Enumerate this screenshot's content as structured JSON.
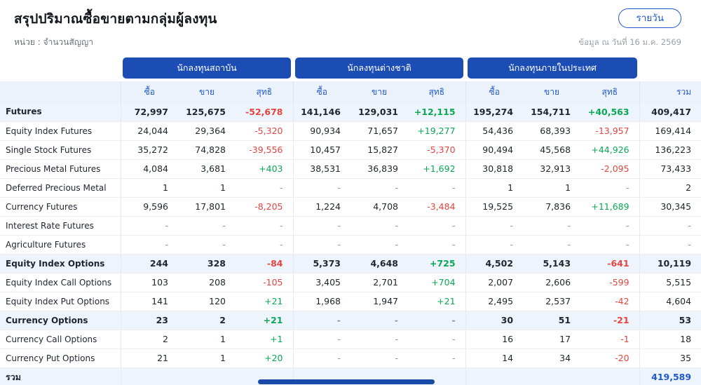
{
  "page": {
    "title": "สรุปปริมาณซื้อขายตามกลุ่มผู้ลงทุน",
    "unit_label": "หน่วย : จำนวนสัญญา",
    "as_of": "ข้อมูล ณ วันที่ 16 ม.ค. 2569",
    "daily_button": "รายวัน"
  },
  "table": {
    "groups": [
      "นักลงทุนสถาบัน",
      "นักลงทุนต่างชาติ",
      "นักลงทุนภายในประเทศ"
    ],
    "sub_headers": [
      "ซื้อ",
      "ขาย",
      "สุทธิ"
    ],
    "total_header": "รวม",
    "rows": [
      {
        "label": "Futures",
        "highlight": true,
        "cells": [
          "72,997",
          "125,675",
          "-52,678",
          "141,146",
          "129,031",
          "+12,115",
          "195,274",
          "154,711",
          "+40,563",
          "409,417"
        ]
      },
      {
        "label": "Equity Index Futures",
        "highlight": false,
        "cells": [
          "24,044",
          "29,364",
          "-5,320",
          "90,934",
          "71,657",
          "+19,277",
          "54,436",
          "68,393",
          "-13,957",
          "169,414"
        ]
      },
      {
        "label": "Single Stock Futures",
        "highlight": false,
        "cells": [
          "35,272",
          "74,828",
          "-39,556",
          "10,457",
          "15,827",
          "-5,370",
          "90,494",
          "45,568",
          "+44,926",
          "136,223"
        ]
      },
      {
        "label": "Precious Metal Futures",
        "highlight": false,
        "cells": [
          "4,084",
          "3,681",
          "+403",
          "38,531",
          "36,839",
          "+1,692",
          "30,818",
          "32,913",
          "-2,095",
          "73,433"
        ]
      },
      {
        "label": "Deferred Precious Metal",
        "highlight": false,
        "cells": [
          "1",
          "1",
          "-",
          "-",
          "-",
          "-",
          "1",
          "1",
          "-",
          "2"
        ]
      },
      {
        "label": "Currency Futures",
        "highlight": false,
        "cells": [
          "9,596",
          "17,801",
          "-8,205",
          "1,224",
          "4,708",
          "-3,484",
          "19,525",
          "7,836",
          "+11,689",
          "30,345"
        ]
      },
      {
        "label": "Interest Rate Futures",
        "highlight": false,
        "cells": [
          "-",
          "-",
          "-",
          "-",
          "-",
          "-",
          "-",
          "-",
          "-",
          "-"
        ]
      },
      {
        "label": "Agriculture Futures",
        "highlight": false,
        "cells": [
          "-",
          "-",
          "-",
          "-",
          "-",
          "-",
          "-",
          "-",
          "-",
          "-"
        ]
      },
      {
        "label": "Equity Index Options",
        "highlight": true,
        "cells": [
          "244",
          "328",
          "-84",
          "5,373",
          "4,648",
          "+725",
          "4,502",
          "5,143",
          "-641",
          "10,119"
        ]
      },
      {
        "label": "Equity Index Call Options",
        "highlight": false,
        "cells": [
          "103",
          "208",
          "-105",
          "3,405",
          "2,701",
          "+704",
          "2,007",
          "2,606",
          "-599",
          "5,515"
        ]
      },
      {
        "label": "Equity Index Put Options",
        "highlight": false,
        "cells": [
          "141",
          "120",
          "+21",
          "1,968",
          "1,947",
          "+21",
          "2,495",
          "2,537",
          "-42",
          "4,604"
        ]
      },
      {
        "label": "Currency Options",
        "highlight": true,
        "cells": [
          "23",
          "2",
          "+21",
          "-",
          "-",
          "-",
          "30",
          "51",
          "-21",
          "53"
        ]
      },
      {
        "label": "Currency Call Options",
        "highlight": false,
        "cells": [
          "2",
          "1",
          "+1",
          "-",
          "-",
          "-",
          "16",
          "17",
          "-1",
          "18"
        ]
      },
      {
        "label": "Currency Put Options",
        "highlight": false,
        "cells": [
          "21",
          "1",
          "+20",
          "-",
          "-",
          "-",
          "14",
          "34",
          "-20",
          "35"
        ]
      }
    ],
    "total_row": {
      "label": "รวม",
      "cells": [
        "",
        "",
        "",
        "",
        "",
        "",
        "",
        "",
        ""
      ],
      "total": "419,589"
    }
  }
}
